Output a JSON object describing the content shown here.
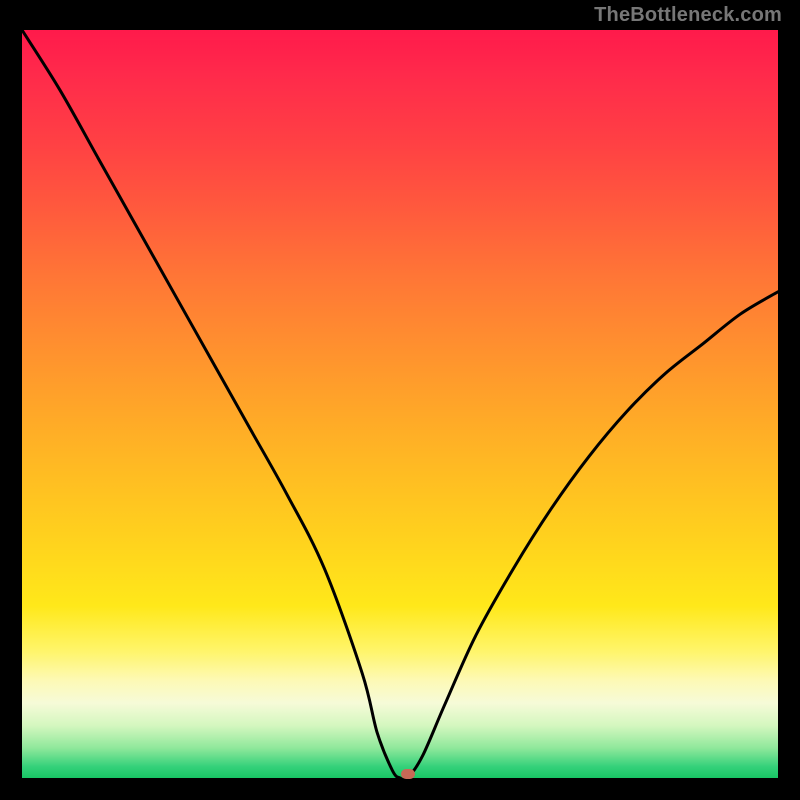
{
  "watermark": "TheBottleneck.com",
  "chart_data": {
    "type": "line",
    "title": "",
    "xlabel": "",
    "ylabel": "",
    "xlim": [
      0,
      100
    ],
    "ylim": [
      0,
      100
    ],
    "x": [
      0,
      5,
      10,
      15,
      20,
      25,
      30,
      35,
      40,
      45,
      47,
      49,
      50,
      51,
      53,
      56,
      60,
      65,
      70,
      75,
      80,
      85,
      90,
      95,
      100
    ],
    "values": [
      100,
      92,
      83,
      74,
      65,
      56,
      47,
      38,
      28,
      14,
      6,
      1,
      0,
      0,
      3,
      10,
      19,
      28,
      36,
      43,
      49,
      54,
      58,
      62,
      65
    ],
    "marker": {
      "x": 51,
      "y": 0
    },
    "gradient_stops": [
      {
        "pct": 0,
        "color": "#ff1a4b"
      },
      {
        "pct": 50,
        "color": "#ffae24"
      },
      {
        "pct": 80,
        "color": "#fff23a"
      },
      {
        "pct": 100,
        "color": "#18c564"
      }
    ]
  },
  "colors": {
    "frame": "#000000",
    "curve": "#000000",
    "marker": "#c86856",
    "watermark": "#777777"
  }
}
